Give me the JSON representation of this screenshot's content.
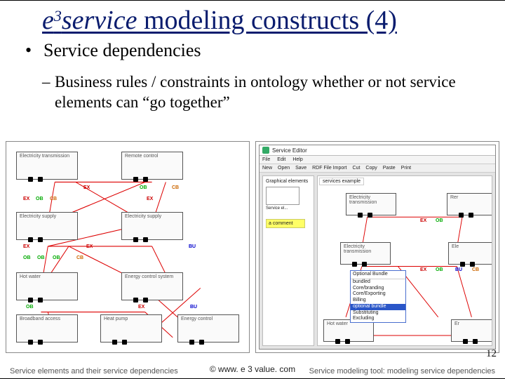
{
  "title": {
    "prefix": "e",
    "super": "3",
    "suffix": "service",
    "rest": " modeling constructs (4)"
  },
  "bullets": {
    "b1": "Service dependencies",
    "sub1": "Business rules / constraints in ontology whether or not service elements can “go together”"
  },
  "left_fig": {
    "nodes": [
      {
        "label": "Electricity transmission"
      },
      {
        "label": "Remote control"
      },
      {
        "label": "Electricity supply"
      },
      {
        "label": "Electricity supply"
      },
      {
        "label": "Hot water"
      },
      {
        "label": "Energy control system"
      },
      {
        "label": "Broadband access"
      },
      {
        "label": "Heat pump"
      },
      {
        "label": "Energy control"
      }
    ],
    "edge_labels": [
      "EX",
      "OB",
      "BU",
      "CB"
    ],
    "caption": "Service elements and their service dependencies"
  },
  "right_fig": {
    "window_title": "Service Editor",
    "menu": [
      "File",
      "Edit",
      "Help"
    ],
    "toolbar": [
      "New",
      "Open",
      "Save",
      "RDF File Import",
      "Cut",
      "Copy",
      "Paste",
      "Print"
    ],
    "left_panel_header": "Graphical elements",
    "left_panel_item": "Service el...",
    "comment": "a comment",
    "tab": "services example",
    "listbox": {
      "header": "Optional Bundle",
      "rows": [
        "bundled",
        "Core/branding",
        "Core/Exporting",
        "Billing",
        "optional bundle",
        "Substituting",
        "Excluding"
      ]
    },
    "nodes": [
      {
        "label": "Electricity transmission"
      },
      {
        "label": "Rer"
      },
      {
        "label": "Electricity transmission"
      },
      {
        "label": "Ele"
      },
      {
        "label": "Hot water"
      },
      {
        "label": "Er"
      }
    ],
    "edge_labels": [
      "EX",
      "OB",
      "BU",
      "CB"
    ],
    "caption": "Service modeling tool: modeling service dependencies"
  },
  "page_number": "12",
  "footer": "© www. e 3 value. com"
}
